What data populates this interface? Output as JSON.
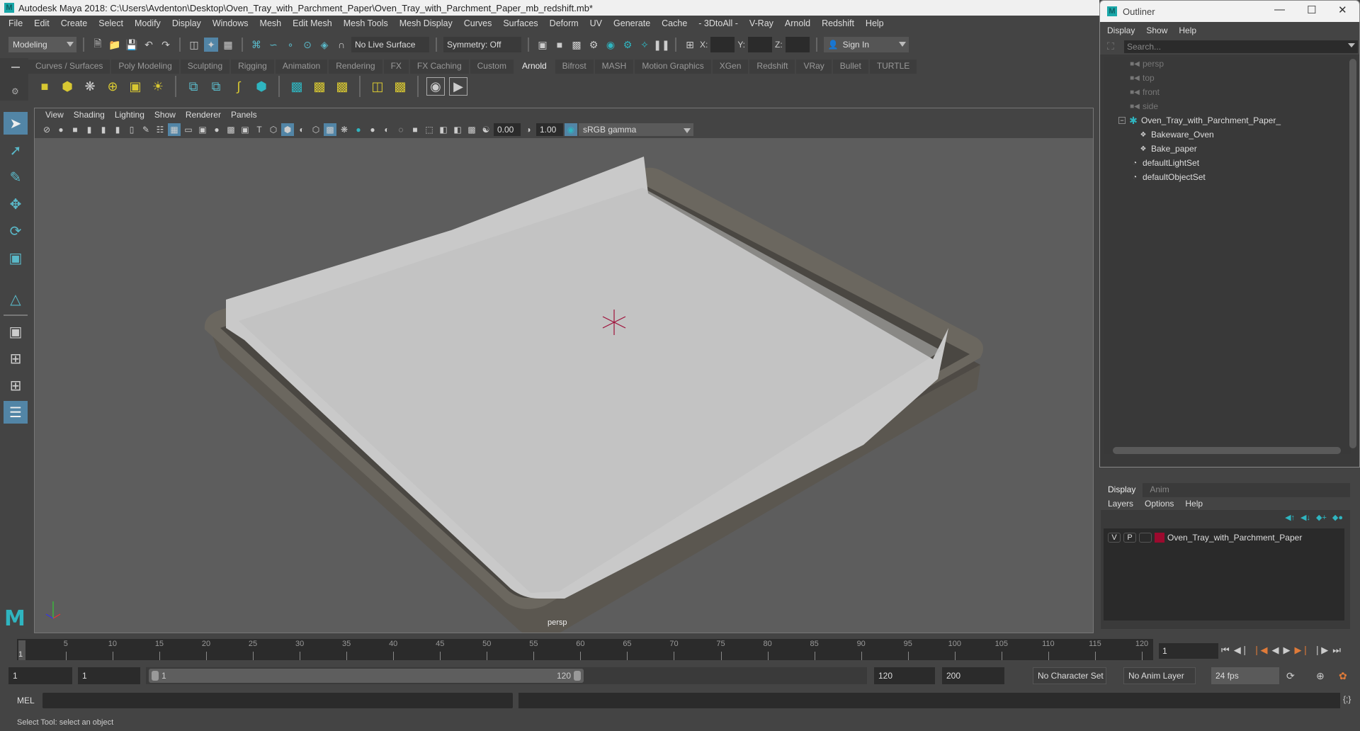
{
  "window": {
    "title": "Autodesk Maya 2018: C:\\Users\\Avdenton\\Desktop\\Oven_Tray_with_Parchment_Paper\\Oven_Tray_with_Parchment_Paper_mb_redshift.mb*"
  },
  "menubar": [
    "File",
    "Edit",
    "Create",
    "Select",
    "Modify",
    "Display",
    "Windows",
    "Mesh",
    "Edit Mesh",
    "Mesh Tools",
    "Mesh Display",
    "Curves",
    "Surfaces",
    "Deform",
    "UV",
    "Generate",
    "Cache",
    "- 3DtoAll -",
    "V-Ray",
    "Arnold",
    "Redshift",
    "Help"
  ],
  "statusline": {
    "mode": "Modeling",
    "live_surface": "No Live Surface",
    "symmetry": "Symmetry: Off",
    "x_label": "X:",
    "y_label": "Y:",
    "z_label": "Z:",
    "sign_in": "Sign In"
  },
  "shelf": {
    "tabs": [
      "Curves / Surfaces",
      "Poly Modeling",
      "Sculpting",
      "Rigging",
      "Animation",
      "Rendering",
      "FX",
      "FX Caching",
      "Custom",
      "Arnold",
      "Bifrost",
      "MASH",
      "Motion Graphics",
      "XGen",
      "Redshift",
      "VRay",
      "Bullet",
      "TURTLE"
    ],
    "active_tab": "Arnold"
  },
  "panel": {
    "menu": [
      "View",
      "Shading",
      "Lighting",
      "Show",
      "Renderer",
      "Panels"
    ],
    "exposure": "0.00",
    "gamma": "1.00",
    "color_space": "sRGB gamma",
    "camera_label": "persp"
  },
  "timeline": {
    "start": 1,
    "end": 120,
    "ticks": [
      5,
      10,
      15,
      20,
      25,
      30,
      35,
      40,
      45,
      50,
      55,
      60,
      65,
      70,
      75,
      80,
      85,
      90,
      95,
      100,
      105,
      110,
      115,
      120
    ],
    "current_frame": "1",
    "current_frame_field": "1"
  },
  "range": {
    "start_field": "1",
    "playback_start_field": "1",
    "slider_start": "1",
    "slider_end": "120",
    "playback_end_field": "120",
    "end_field": "200",
    "character_set": "No Character Set",
    "anim_layer": "No Anim Layer",
    "fps": "24 fps"
  },
  "cmdline": {
    "label": "MEL"
  },
  "status_message": "Select Tool: select an object",
  "outliner": {
    "title": "Outliner",
    "menu": [
      "Display",
      "Show",
      "Help"
    ],
    "search_placeholder": "Search...",
    "items": [
      {
        "label": "persp",
        "type": "camera",
        "dim": true
      },
      {
        "label": "top",
        "type": "camera",
        "dim": true
      },
      {
        "label": "front",
        "type": "camera",
        "dim": true
      },
      {
        "label": "side",
        "type": "camera",
        "dim": true
      },
      {
        "label": "Oven_Tray_with_Parchment_Paper_",
        "type": "group",
        "dim": false
      },
      {
        "label": "Bakeware_Oven",
        "type": "mesh",
        "dim": false
      },
      {
        "label": "Bake_paper",
        "type": "mesh",
        "dim": false
      },
      {
        "label": "defaultLightSet",
        "type": "set",
        "dim": false
      },
      {
        "label": "defaultObjectSet",
        "type": "set",
        "dim": false
      }
    ]
  },
  "layers": {
    "tabs": [
      "Display",
      "Anim"
    ],
    "active_tab": "Display",
    "menu": [
      "Layers",
      "Options",
      "Help"
    ],
    "rows": [
      {
        "v": "V",
        "p": "P",
        "name": "Oven_Tray_with_Parchment_Paper",
        "color": "#9b0a2e"
      }
    ]
  },
  "colors": {
    "accent": "#5285a6",
    "teal": "#2fb5c0",
    "orange": "#e07b39"
  }
}
